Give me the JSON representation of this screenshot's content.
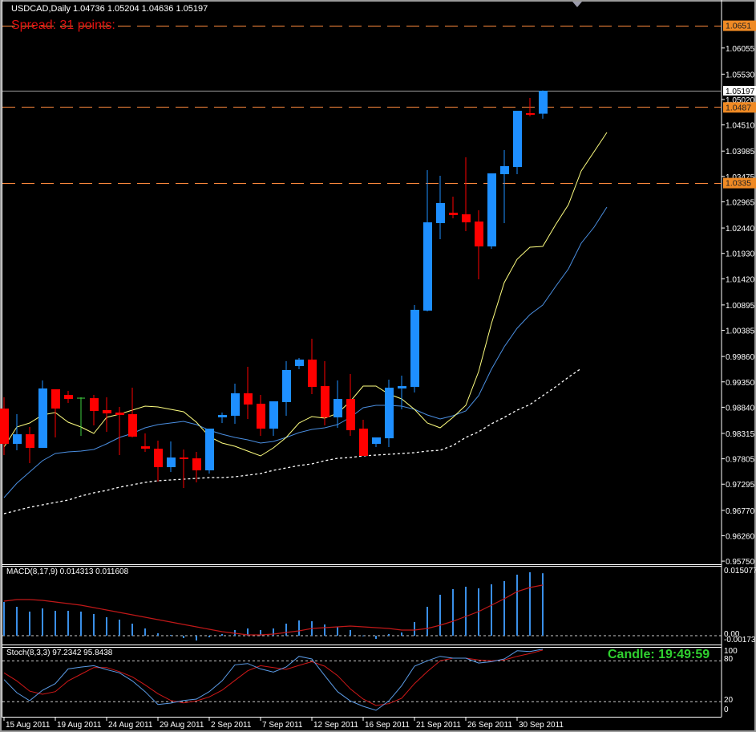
{
  "window": {
    "title": "USDCAD,Daily  1.04736 1.05204 1.04636 1.05197",
    "spread_text": "Spread: 31 points:",
    "candle_timer": "Candle:  19:49:59"
  },
  "colors": {
    "background": "#000000",
    "bull": "#1e8fff",
    "bear": "#ff0000",
    "doji": "#40d040",
    "ma_fast": "#ffff80",
    "ma_mid": "#4a8ee0",
    "ma_slow": "#ffffff",
    "hline": "#ff8a3d",
    "macd_hist": "#3a8fe8",
    "macd_signal": "#c01818",
    "stoch_k": "#5b9be6",
    "stoch_d": "#d01818"
  },
  "chart_data": {
    "type": "candlestick",
    "symbol": "USDCAD",
    "timeframe": "Daily",
    "ylim": [
      0.95687,
      1.07019
    ],
    "current_price": "1.05197",
    "price_axis": [
      "1.06055",
      "1.05530",
      "1.05020",
      "1.04510",
      "1.03985",
      "1.03475",
      "1.02965",
      "1.02440",
      "1.01930",
      "1.01420",
      "1.00895",
      "1.00385",
      "0.99860",
      "0.99350",
      "0.98840",
      "0.98315",
      "0.97805",
      "0.97295",
      "0.96770",
      "0.96260",
      "0.95750"
    ],
    "hlines": [
      "1.0651",
      "1.0487",
      "1.0335"
    ],
    "date_labels": [
      {
        "label": "15 Aug 2011",
        "bar": 0
      },
      {
        "label": "19 Aug 2011",
        "bar": 4
      },
      {
        "label": "24 Aug 2011",
        "bar": 8
      },
      {
        "label": "29 Aug 2011",
        "bar": 12
      },
      {
        "label": "2 Sep 2011",
        "bar": 16
      },
      {
        "label": "7 Sep 2011",
        "bar": 20
      },
      {
        "label": "12 Sep 2011",
        "bar": 24
      },
      {
        "label": "16 Sep 2011",
        "bar": 28
      },
      {
        "label": "21 Sep 2011",
        "bar": 32
      },
      {
        "label": "26 Sep 2011",
        "bar": 36
      },
      {
        "label": "30 Sep 2011",
        "bar": 40
      }
    ],
    "ohlc": [
      [
        0.98814,
        0.9904,
        0.97879,
        0.98105
      ],
      [
        0.98105,
        0.98701,
        0.97976,
        0.98298
      ],
      [
        0.98298,
        0.98443,
        0.97718,
        0.98024
      ],
      [
        0.98024,
        0.99378,
        0.98024,
        0.99217
      ],
      [
        0.99201,
        0.99201,
        0.98234,
        0.98814
      ],
      [
        0.99088,
        0.99169,
        0.98927,
        0.99007
      ],
      [
        0.99023,
        0.9904,
        0.98266,
        0.99023
      ],
      [
        0.99023,
        0.99088,
        0.98475,
        0.98766
      ],
      [
        0.98782,
        0.9904,
        0.98346,
        0.98717
      ],
      [
        0.98733,
        0.98846,
        0.97879,
        0.98685
      ],
      [
        0.98701,
        0.99233,
        0.98234,
        0.9825
      ],
      [
        0.98056,
        0.98314,
        0.97943,
        0.98008
      ],
      [
        0.98008,
        0.98169,
        0.97347,
        0.97637
      ],
      [
        0.97637,
        0.98153,
        0.9754,
        0.97831
      ],
      [
        0.97831,
        0.97992,
        0.97218,
        0.97814
      ],
      [
        0.97814,
        0.97943,
        0.97331,
        0.97573
      ],
      [
        0.97573,
        0.98411,
        0.97508,
        0.98411
      ],
      [
        0.98637,
        0.98733,
        0.98524,
        0.98685
      ],
      [
        0.98669,
        0.99314,
        0.98508,
        0.9912
      ],
      [
        0.9912,
        0.99652,
        0.98604,
        0.98895
      ],
      [
        0.98911,
        0.99088,
        0.98266,
        0.98411
      ],
      [
        0.98411,
        0.98959,
        0.98266,
        0.98959
      ],
      [
        0.98943,
        0.99765,
        0.98669,
        0.99588
      ],
      [
        0.99668,
        0.99829,
        0.99604,
        0.99797
      ],
      [
        0.99797,
        1.00216,
        0.99104,
        0.99249
      ],
      [
        0.99265,
        0.99765,
        0.98475,
        0.98637
      ],
      [
        0.98637,
        0.99378,
        0.98427,
        0.99007
      ],
      [
        0.99007,
        0.99507,
        0.98266,
        0.98379
      ],
      [
        0.98411,
        0.98588,
        0.97863,
        0.97863
      ],
      [
        0.98105,
        0.98234,
        0.9804,
        0.98234
      ],
      [
        0.98217,
        0.99394,
        0.9804,
        0.99233
      ],
      [
        0.99217,
        0.99475,
        0.98798,
        0.99265
      ],
      [
        0.99249,
        1.00893,
        0.99136,
        1.00797
      ],
      [
        1.00781,
        1.03602,
        1.00764,
        1.02554
      ],
      [
        1.02538,
        1.03489,
        1.02215,
        1.02941
      ],
      [
        1.02747,
        1.0307,
        1.02634,
        1.02699
      ],
      [
        1.02715,
        1.03859,
        1.02376,
        1.02554
      ],
      [
        1.0257,
        1.02796,
        1.01409,
        1.0207
      ],
      [
        1.0207,
        1.03537,
        1.02022,
        1.03537
      ],
      [
        1.03521,
        1.04005,
        1.02538,
        1.03682
      ],
      [
        1.03666,
        1.04794,
        1.03521,
        1.04794
      ],
      [
        1.04746,
        1.05052,
        1.04682,
        1.04714
      ],
      [
        1.04736,
        1.05204,
        1.04636,
        1.05197
      ]
    ],
    "ma_fast": [
      0.9804,
      0.98443,
      0.98524,
      0.98685,
      0.98733,
      0.9854,
      0.98443,
      0.98314,
      0.98637,
      0.98701,
      0.98782,
      0.98862,
      0.98846,
      0.98798,
      0.98749,
      0.9854,
      0.9825,
      0.98121,
      0.98056,
      0.9796,
      0.97863,
      0.98024,
      0.98234,
      0.98524,
      0.98653,
      0.9862,
      0.98717,
      0.98959,
      0.99265,
      0.99265,
      0.99104,
      0.99007,
      0.98798,
      0.98524,
      0.98427,
      0.98637,
      0.98878,
      0.99555,
      1.00523,
      1.01345,
      1.01812,
      1.02054,
      1.0207,
      1.02505,
      1.02908,
      1.03585,
      1.03972,
      1.04359
    ],
    "ma_mid": [
      0.97025,
      0.97315,
      0.9754,
      0.97766,
      0.97911,
      0.97943,
      0.9796,
      0.97992,
      0.98105,
      0.98234,
      0.98314,
      0.98427,
      0.98492,
      0.98524,
      0.98556,
      0.98492,
      0.98379,
      0.98298,
      0.98234,
      0.98185,
      0.98121,
      0.98153,
      0.98234,
      0.9833,
      0.98395,
      0.98427,
      0.98492,
      0.98637,
      0.9883,
      0.98878,
      0.98878,
      0.98862,
      0.98798,
      0.98685,
      0.98604,
      0.98669,
      0.98766,
      0.99072,
      0.99604,
      1.00055,
      1.00426,
      1.007,
      1.00893,
      1.01264,
      1.01619,
      1.02135,
      1.02457,
      1.0286
    ],
    "ma_slow": [
      0.96702,
      0.96767,
      0.96831,
      0.9688,
      0.96928,
      0.96976,
      0.97057,
      0.97121,
      0.9717,
      0.97234,
      0.97283,
      0.97331,
      0.97363,
      0.97379,
      0.97395,
      0.97411,
      0.97428,
      0.97428,
      0.97444,
      0.97476,
      0.97508,
      0.97573,
      0.97621,
      0.97669,
      0.97702,
      0.97766,
      0.97814,
      0.97831,
      0.97863,
      0.97879,
      0.97895,
      0.97911,
      0.97927,
      0.9796,
      0.97976,
      0.98072,
      0.98234,
      0.98346,
      0.98508,
      0.98637,
      0.98782,
      0.98895,
      0.99072,
      0.99249,
      0.99443,
      0.9962
    ],
    "macd": {
      "label": "MACD(8,17,9) 0.014313 0.011608",
      "ylim": [
        -0.00202,
        0.016
      ],
      "axis_labels": {
        "top": "0.015077",
        "zero": "0.00",
        "bottom": "-0.00173"
      },
      "histogram": [
        0.00772,
        0.00662,
        0.00552,
        0.00625,
        0.0057,
        0.0057,
        0.00552,
        0.00497,
        0.00423,
        0.00368,
        0.00276,
        0.00166,
        0.00055,
        0.00018,
        -0.00055,
        -0.0011,
        -0.00037,
        0.00037,
        0.00129,
        0.00166,
        0.00129,
        0.00166,
        0.00276,
        0.00349,
        0.00331,
        0.00257,
        0.00202,
        0.00129,
        5e-05,
        -0.00074,
        0.00037,
        0.00074,
        0.00313,
        0.00662,
        0.00938,
        0.01067,
        0.01122,
        0.01085,
        0.01177,
        0.01251,
        0.01398,
        0.01453,
        0.01431
      ],
      "signal": [
        0.00791,
        0.00828,
        0.00828,
        0.00809,
        0.00772,
        0.00736,
        0.00699,
        0.00644,
        0.00588,
        0.00533,
        0.00478,
        0.00423,
        0.00368,
        0.00313,
        0.00257,
        0.00202,
        0.00147,
        0.00092,
        0.00055,
        0.00018,
        0.00018,
        0.00037,
        0.00074,
        0.0011,
        0.00166,
        0.00184,
        0.00202,
        0.00221,
        0.00202,
        0.00184,
        0.00166,
        0.00129,
        0.00129,
        0.00166,
        0.00239,
        0.00331,
        0.00441,
        0.00552,
        0.00699,
        0.00846,
        0.01011,
        0.01103,
        0.01161
      ]
    },
    "stoch": {
      "label": "Stoch(8,3,3) 97.2342 95.8438",
      "ylim": [
        -2,
        100.4
      ],
      "levels": [
        80,
        20
      ],
      "axis_labels": [
        "100",
        "80",
        "20",
        "0"
      ],
      "k": [
        52.5,
        33.3,
        21.5,
        36.8,
        46.6,
        68.2,
        70.9,
        72.9,
        67.1,
        62.4,
        50.6,
        34.8,
        16.0,
        18.0,
        21.9,
        23.9,
        34.8,
        50.6,
        74.1,
        76.0,
        68.2,
        63.5,
        71.0,
        86.6,
        82.7,
        58.4,
        34.8,
        21.2,
        13.3,
        7.4,
        21.2,
        43.5,
        72.1,
        80.0,
        86.6,
        83.9,
        83.9,
        76.8,
        78.8,
        82.7,
        94.8,
        93.6,
        97.2
      ],
      "d": [
        62.4,
        50.6,
        35.6,
        30.9,
        34.8,
        50.6,
        60.4,
        70.1,
        70.1,
        64.2,
        56.5,
        44.7,
        31.8,
        21.9,
        18.4,
        21.2,
        27.1,
        36.8,
        51.3,
        65.4,
        72.9,
        70.1,
        67.4,
        73.3,
        78.8,
        72.1,
        58.4,
        38.8,
        23.9,
        14.5,
        17.2,
        25.1,
        46.6,
        64.2,
        80.0,
        83.9,
        83.9,
        81.2,
        80.0,
        81.2,
        86.6,
        90.6,
        95.8
      ]
    }
  }
}
